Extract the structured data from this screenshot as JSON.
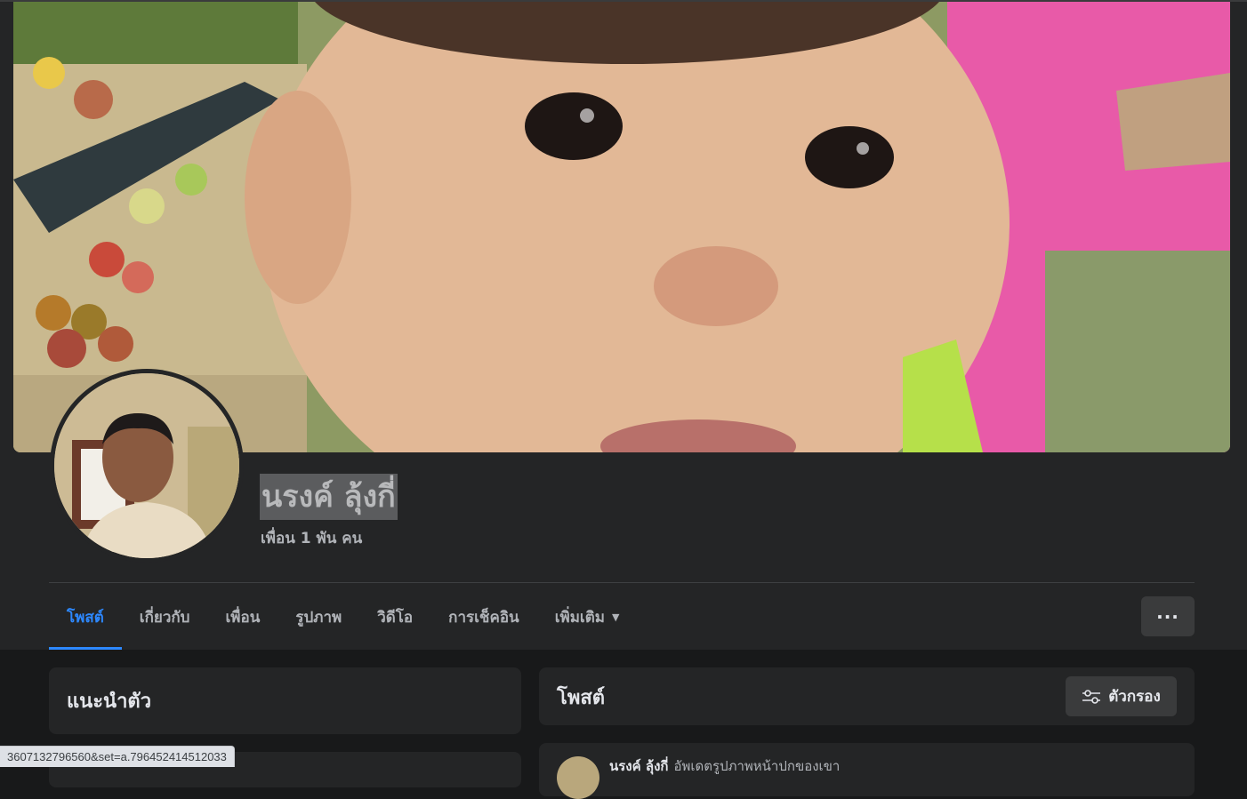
{
  "profile": {
    "name": "นรงค์ ลุ้งกี่",
    "friends_count": "เพื่อน 1 พัน คน"
  },
  "tabs": [
    {
      "label": "โพสต์",
      "active": true
    },
    {
      "label": "เกี่ยวกับ"
    },
    {
      "label": "เพื่อน"
    },
    {
      "label": "รูปภาพ"
    },
    {
      "label": "วิดีโอ"
    },
    {
      "label": "การเช็คอิน"
    },
    {
      "label": "เพิ่มเติม"
    }
  ],
  "more_button": {
    "label": "···",
    "icon": "ellipsis-icon"
  },
  "intro": {
    "title": "แนะนำตัว"
  },
  "posts": {
    "title": "โพสต์",
    "filter_label": "ตัวกรอง",
    "filter_icon": "sliders-icon",
    "first_post": {
      "author": "นรงค์ ลุ้งกี่",
      "description": "อัพเดตรูปภาพหน้าปกของเขา"
    }
  },
  "status_bar": {
    "url": "3607132796560&set=a.796452414512033"
  },
  "colors": {
    "accent": "#2d88ff",
    "background": "#18191a",
    "surface": "#242526",
    "button": "#3a3b3c"
  }
}
